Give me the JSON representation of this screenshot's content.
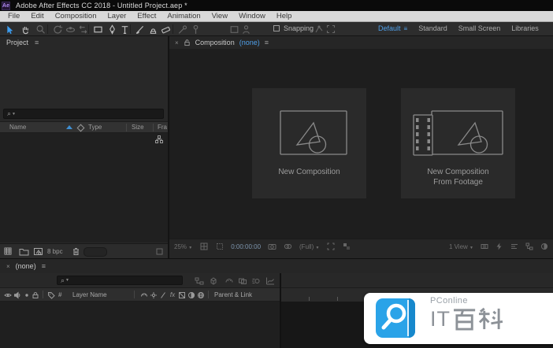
{
  "titlebar": {
    "app_icon_label": "Ae",
    "title": "Adobe After Effects CC 2018 - Untitled Project.aep *"
  },
  "menubar": {
    "items": [
      "File",
      "Edit",
      "Composition",
      "Layer",
      "Effect",
      "Animation",
      "View",
      "Window",
      "Help"
    ]
  },
  "toolbar": {
    "tools": [
      "selection-tool",
      "hand-tool",
      "zoom-tool",
      "rotation-tool",
      "unified-camera-tool",
      "pan-behind-tool",
      "rectangle-tool",
      "pen-tool",
      "type-tool",
      "brush-tool",
      "clone-stamp-tool",
      "eraser-tool",
      "roto-brush-tool",
      "puppet-pin-tool"
    ],
    "snapping_label": "Snapping",
    "workspaces": [
      {
        "label": "Default",
        "active": true
      },
      {
        "label": "Standard",
        "active": false
      },
      {
        "label": "Small Screen",
        "active": false
      },
      {
        "label": "Libraries",
        "active": false
      }
    ]
  },
  "project_panel": {
    "tab_label": "Project",
    "columns": {
      "name": "Name",
      "type": "Type",
      "size": "Size",
      "frame": "Fra"
    },
    "footer": {
      "bit_depth": "8 bpc"
    }
  },
  "composition_panel": {
    "tab_label": "Composition",
    "tab_target": "(none)",
    "cards": [
      {
        "label_line1": "New Composition",
        "label_line2": ""
      },
      {
        "label_line1": "New Composition",
        "label_line2": "From Footage"
      }
    ],
    "statusbar": {
      "magnification": "25%",
      "timecode": "0:00:00:00",
      "resolution": "(Full)",
      "view_layout": "1 View"
    }
  },
  "timeline_panel": {
    "tab_label": "(none)",
    "columns": {
      "index": "#",
      "layer_name": "Layer Name",
      "parent_link": "Parent & Link"
    }
  },
  "watermark": {
    "brand": "PConline",
    "title": "IT百科",
    "title_latin": "IT"
  },
  "colors": {
    "accent_blue": "#3f8fd2",
    "workspace_active": "#4f9fe8",
    "watermark_blue": "#2aa3e8"
  }
}
